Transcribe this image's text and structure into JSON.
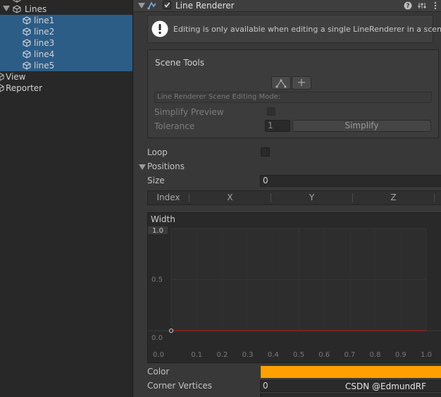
{
  "hierarchy": {
    "items": [
      {
        "label": "Lines"
      },
      {
        "label": "line1"
      },
      {
        "label": "line2"
      },
      {
        "label": "line3"
      },
      {
        "label": "line4"
      },
      {
        "label": "line5"
      },
      {
        "label": "View"
      },
      {
        "label": "Reporter"
      }
    ]
  },
  "inspector": {
    "component_title": "Line Renderer",
    "enabled": true,
    "help_message": "Editing is only available when editing a single LineRenderer in a scene.",
    "scene_tools": {
      "title": "Scene Tools",
      "mode_label": "Line Renderer Scene Editing Mode:",
      "simplify_preview_label": "Simplify Preview",
      "tolerance_label": "Tolerance",
      "tolerance_value": "1",
      "simplify_button": "Simplify"
    },
    "loop_label": "Loop",
    "positions": {
      "label": "Positions",
      "size_label": "Size",
      "size_value": "0",
      "columns": [
        "Index",
        "X",
        "Y",
        "Z"
      ]
    },
    "width_curve": {
      "label": "Width",
      "y_ticks": [
        "1.0",
        "0.5",
        "0.0"
      ],
      "x_ticks": [
        "0.0",
        "0.1",
        "0.2",
        "0.3",
        "0.4",
        "0.5",
        "0.6",
        "0.7",
        "0.8",
        "0.9",
        "1.0"
      ],
      "curve_value": 0.0,
      "curve_color": "#b01818"
    },
    "color_label": "Color",
    "color_value": "#ffa000",
    "corner_vertices_label": "Corner Vertices",
    "corner_vertices_value": "0"
  },
  "watermark": "CSDN @EdmundRF"
}
